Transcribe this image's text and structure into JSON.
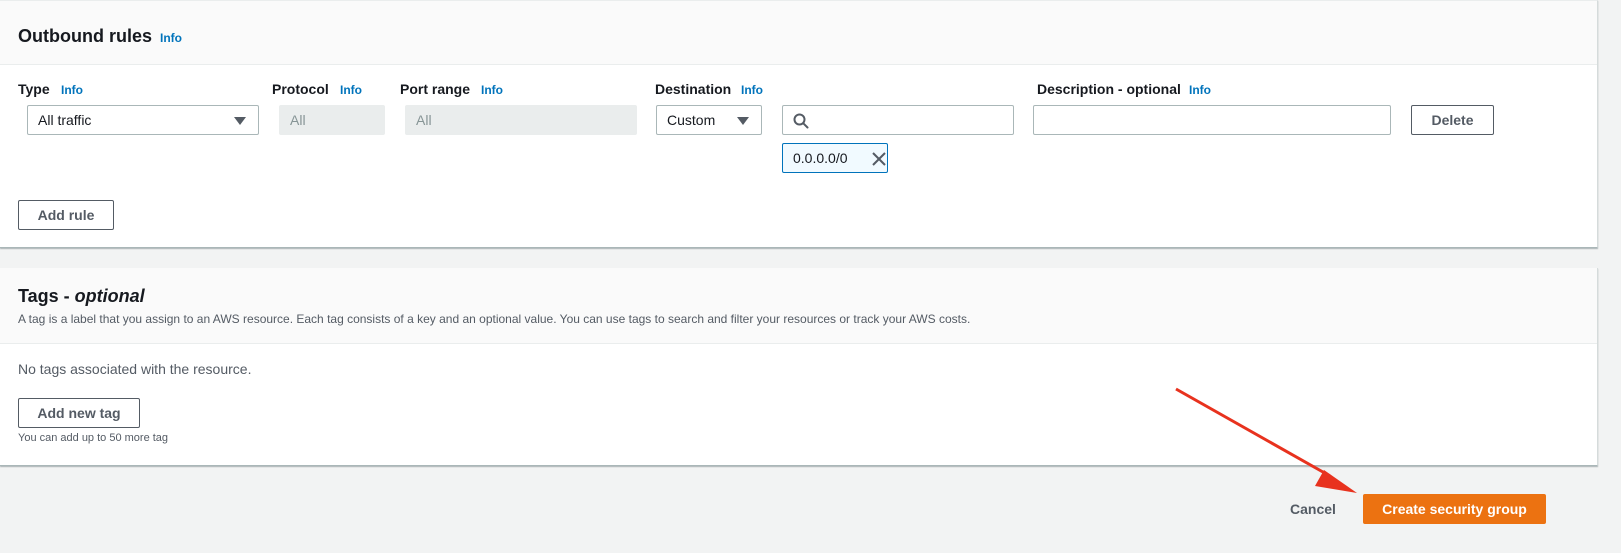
{
  "outbound": {
    "title": "Outbound rules",
    "info": "Info",
    "columns": {
      "type": "Type",
      "protocol": "Protocol",
      "port_range": "Port range",
      "destination": "Destination",
      "description": "Description - optional"
    },
    "rule": {
      "type_value": "All traffic",
      "protocol_value": "All",
      "port_range_value": "All",
      "destination_mode": "Custom",
      "destination_search_value": "",
      "destination_token": "0.0.0.0/0",
      "description_value": ""
    },
    "delete_label": "Delete",
    "add_rule_label": "Add rule"
  },
  "tags": {
    "title_prefix": "Tags - ",
    "title_optional": "optional",
    "description": "A tag is a label that you assign to an AWS resource. Each tag consists of a key and an optional value. You can use tags to search and filter your resources or track your AWS costs.",
    "empty_text": "No tags associated with the resource.",
    "add_tag_label": "Add new tag",
    "limit_text": "You can add up to 50 more tag"
  },
  "footer": {
    "cancel_label": "Cancel",
    "create_label": "Create security group"
  },
  "colors": {
    "primary": "#ec7211",
    "link": "#0073bb",
    "annotation_arrow": "#e8321e"
  },
  "icons": [
    "search-icon",
    "close-icon",
    "caret-down-icon"
  ]
}
